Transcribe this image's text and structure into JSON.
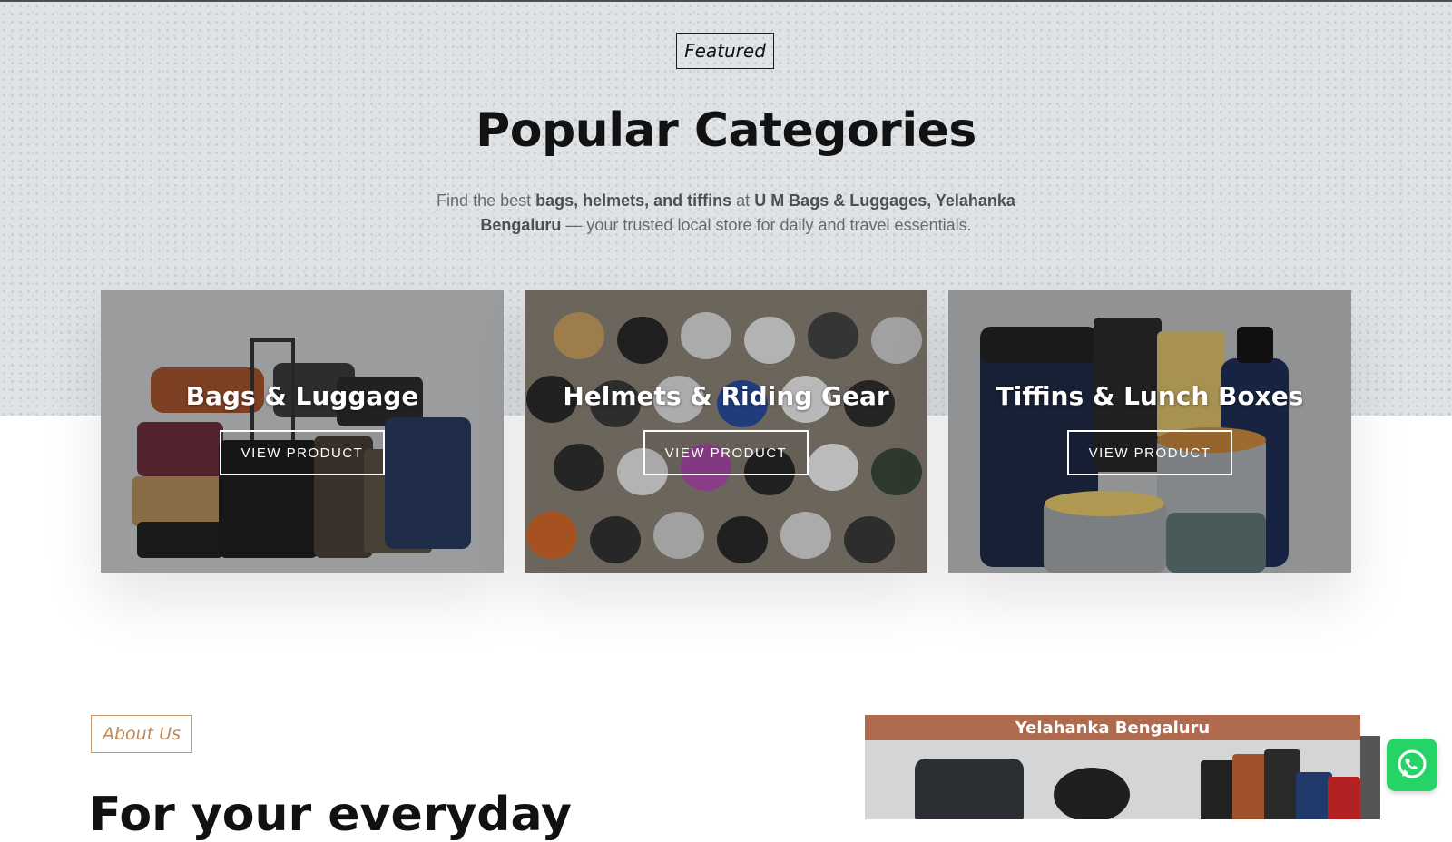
{
  "section": {
    "badge": "Featured",
    "title": "Popular Categories",
    "subtitle": {
      "p1": "Find the best ",
      "b1": "bags, helmets, and tiffins",
      "p2": " at ",
      "b2": "U M Bags & Luggages, Yelahanka Bengaluru",
      "p3": " — your trusted local store for daily and travel essentials."
    }
  },
  "categories": [
    {
      "title": "Bags & Luggage",
      "button": "VIEW PRODUCT",
      "image_icon": "luggage-photo"
    },
    {
      "title": "Helmets & Riding Gear",
      "button": "VIEW PRODUCT",
      "image_icon": "helmets-photo"
    },
    {
      "title": "Tiffins & Lunch Boxes",
      "button": "VIEW PRODUCT",
      "image_icon": "tiffins-photo"
    }
  ],
  "about": {
    "badge": "About Us",
    "heading": "For your everyday"
  },
  "promo": {
    "banner": "Yelahanka Bengaluru"
  },
  "whatsapp": {
    "icon": "whatsapp-icon"
  },
  "colors": {
    "accent": "#c08a55",
    "banner": "#b06a4d",
    "whatsapp": "#25d366"
  }
}
